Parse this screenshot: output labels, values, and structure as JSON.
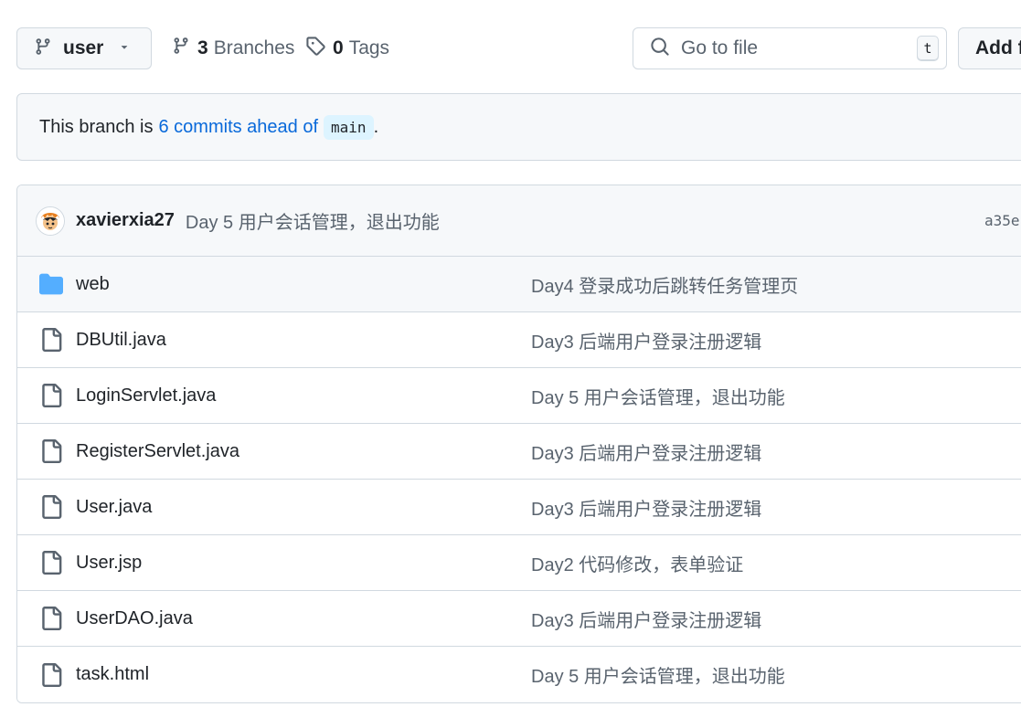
{
  "toolbar": {
    "branch_label": "user",
    "branches_count": "3",
    "branches_word": "Branches",
    "tags_count": "0",
    "tags_word": "Tags",
    "goto_placeholder": "Go to file",
    "goto_shortcut": "t",
    "add_file_label": "Add f"
  },
  "ahead": {
    "prefix": "This branch is",
    "link": "6 commits ahead of",
    "branch": "main",
    "suffix": "."
  },
  "latest_commit": {
    "author": "xavierxia27",
    "message": "Day 5 用户会话管理，退出功能",
    "sha": "a35e"
  },
  "files": [
    {
      "type": "folder",
      "name": "web",
      "message": "Day4 登录成功后跳转任务管理页"
    },
    {
      "type": "file",
      "name": "DBUtil.java",
      "message": "Day3 后端用户登录注册逻辑"
    },
    {
      "type": "file",
      "name": "LoginServlet.java",
      "message": "Day 5 用户会话管理，退出功能"
    },
    {
      "type": "file",
      "name": "RegisterServlet.java",
      "message": "Day3 后端用户登录注册逻辑"
    },
    {
      "type": "file",
      "name": "User.java",
      "message": "Day3 后端用户登录注册逻辑"
    },
    {
      "type": "file",
      "name": "User.jsp",
      "message": "Day2 代码修改，表单验证"
    },
    {
      "type": "file",
      "name": "UserDAO.java",
      "message": "Day3 后端用户登录注册逻辑"
    },
    {
      "type": "file",
      "name": "task.html",
      "message": "Day 5 用户会话管理，退出功能"
    }
  ],
  "colors": {
    "accent_link": "#0969da",
    "folder_icon": "#54aeff",
    "muted_text": "#59636e",
    "border": "#d1d9e0",
    "subtle_bg": "#f6f8fa"
  },
  "icons": {
    "branch": "git-branch-icon",
    "caret": "triangle-down-icon",
    "tag": "tag-icon",
    "search": "search-icon",
    "folder": "folder-icon",
    "file": "file-icon"
  }
}
